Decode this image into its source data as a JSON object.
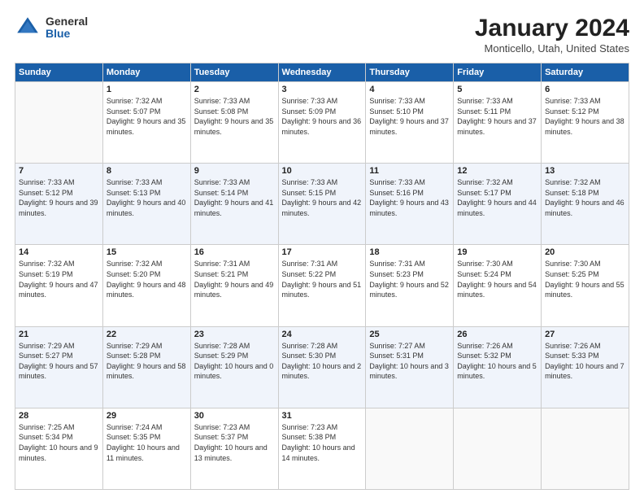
{
  "logo": {
    "general": "General",
    "blue": "Blue"
  },
  "header": {
    "title": "January 2024",
    "location": "Monticello, Utah, United States"
  },
  "days_of_week": [
    "Sunday",
    "Monday",
    "Tuesday",
    "Wednesday",
    "Thursday",
    "Friday",
    "Saturday"
  ],
  "weeks": [
    [
      {
        "day": "",
        "sunrise": "",
        "sunset": "",
        "daylight": ""
      },
      {
        "day": "1",
        "sunrise": "Sunrise: 7:32 AM",
        "sunset": "Sunset: 5:07 PM",
        "daylight": "Daylight: 9 hours and 35 minutes."
      },
      {
        "day": "2",
        "sunrise": "Sunrise: 7:33 AM",
        "sunset": "Sunset: 5:08 PM",
        "daylight": "Daylight: 9 hours and 35 minutes."
      },
      {
        "day": "3",
        "sunrise": "Sunrise: 7:33 AM",
        "sunset": "Sunset: 5:09 PM",
        "daylight": "Daylight: 9 hours and 36 minutes."
      },
      {
        "day": "4",
        "sunrise": "Sunrise: 7:33 AM",
        "sunset": "Sunset: 5:10 PM",
        "daylight": "Daylight: 9 hours and 37 minutes."
      },
      {
        "day": "5",
        "sunrise": "Sunrise: 7:33 AM",
        "sunset": "Sunset: 5:11 PM",
        "daylight": "Daylight: 9 hours and 37 minutes."
      },
      {
        "day": "6",
        "sunrise": "Sunrise: 7:33 AM",
        "sunset": "Sunset: 5:12 PM",
        "daylight": "Daylight: 9 hours and 38 minutes."
      }
    ],
    [
      {
        "day": "7",
        "sunrise": "Sunrise: 7:33 AM",
        "sunset": "Sunset: 5:12 PM",
        "daylight": "Daylight: 9 hours and 39 minutes."
      },
      {
        "day": "8",
        "sunrise": "Sunrise: 7:33 AM",
        "sunset": "Sunset: 5:13 PM",
        "daylight": "Daylight: 9 hours and 40 minutes."
      },
      {
        "day": "9",
        "sunrise": "Sunrise: 7:33 AM",
        "sunset": "Sunset: 5:14 PM",
        "daylight": "Daylight: 9 hours and 41 minutes."
      },
      {
        "day": "10",
        "sunrise": "Sunrise: 7:33 AM",
        "sunset": "Sunset: 5:15 PM",
        "daylight": "Daylight: 9 hours and 42 minutes."
      },
      {
        "day": "11",
        "sunrise": "Sunrise: 7:33 AM",
        "sunset": "Sunset: 5:16 PM",
        "daylight": "Daylight: 9 hours and 43 minutes."
      },
      {
        "day": "12",
        "sunrise": "Sunrise: 7:32 AM",
        "sunset": "Sunset: 5:17 PM",
        "daylight": "Daylight: 9 hours and 44 minutes."
      },
      {
        "day": "13",
        "sunrise": "Sunrise: 7:32 AM",
        "sunset": "Sunset: 5:18 PM",
        "daylight": "Daylight: 9 hours and 46 minutes."
      }
    ],
    [
      {
        "day": "14",
        "sunrise": "Sunrise: 7:32 AM",
        "sunset": "Sunset: 5:19 PM",
        "daylight": "Daylight: 9 hours and 47 minutes."
      },
      {
        "day": "15",
        "sunrise": "Sunrise: 7:32 AM",
        "sunset": "Sunset: 5:20 PM",
        "daylight": "Daylight: 9 hours and 48 minutes."
      },
      {
        "day": "16",
        "sunrise": "Sunrise: 7:31 AM",
        "sunset": "Sunset: 5:21 PM",
        "daylight": "Daylight: 9 hours and 49 minutes."
      },
      {
        "day": "17",
        "sunrise": "Sunrise: 7:31 AM",
        "sunset": "Sunset: 5:22 PM",
        "daylight": "Daylight: 9 hours and 51 minutes."
      },
      {
        "day": "18",
        "sunrise": "Sunrise: 7:31 AM",
        "sunset": "Sunset: 5:23 PM",
        "daylight": "Daylight: 9 hours and 52 minutes."
      },
      {
        "day": "19",
        "sunrise": "Sunrise: 7:30 AM",
        "sunset": "Sunset: 5:24 PM",
        "daylight": "Daylight: 9 hours and 54 minutes."
      },
      {
        "day": "20",
        "sunrise": "Sunrise: 7:30 AM",
        "sunset": "Sunset: 5:25 PM",
        "daylight": "Daylight: 9 hours and 55 minutes."
      }
    ],
    [
      {
        "day": "21",
        "sunrise": "Sunrise: 7:29 AM",
        "sunset": "Sunset: 5:27 PM",
        "daylight": "Daylight: 9 hours and 57 minutes."
      },
      {
        "day": "22",
        "sunrise": "Sunrise: 7:29 AM",
        "sunset": "Sunset: 5:28 PM",
        "daylight": "Daylight: 9 hours and 58 minutes."
      },
      {
        "day": "23",
        "sunrise": "Sunrise: 7:28 AM",
        "sunset": "Sunset: 5:29 PM",
        "daylight": "Daylight: 10 hours and 0 minutes."
      },
      {
        "day": "24",
        "sunrise": "Sunrise: 7:28 AM",
        "sunset": "Sunset: 5:30 PM",
        "daylight": "Daylight: 10 hours and 2 minutes."
      },
      {
        "day": "25",
        "sunrise": "Sunrise: 7:27 AM",
        "sunset": "Sunset: 5:31 PM",
        "daylight": "Daylight: 10 hours and 3 minutes."
      },
      {
        "day": "26",
        "sunrise": "Sunrise: 7:26 AM",
        "sunset": "Sunset: 5:32 PM",
        "daylight": "Daylight: 10 hours and 5 minutes."
      },
      {
        "day": "27",
        "sunrise": "Sunrise: 7:26 AM",
        "sunset": "Sunset: 5:33 PM",
        "daylight": "Daylight: 10 hours and 7 minutes."
      }
    ],
    [
      {
        "day": "28",
        "sunrise": "Sunrise: 7:25 AM",
        "sunset": "Sunset: 5:34 PM",
        "daylight": "Daylight: 10 hours and 9 minutes."
      },
      {
        "day": "29",
        "sunrise": "Sunrise: 7:24 AM",
        "sunset": "Sunset: 5:35 PM",
        "daylight": "Daylight: 10 hours and 11 minutes."
      },
      {
        "day": "30",
        "sunrise": "Sunrise: 7:23 AM",
        "sunset": "Sunset: 5:37 PM",
        "daylight": "Daylight: 10 hours and 13 minutes."
      },
      {
        "day": "31",
        "sunrise": "Sunrise: 7:23 AM",
        "sunset": "Sunset: 5:38 PM",
        "daylight": "Daylight: 10 hours and 14 minutes."
      },
      {
        "day": "",
        "sunrise": "",
        "sunset": "",
        "daylight": ""
      },
      {
        "day": "",
        "sunrise": "",
        "sunset": "",
        "daylight": ""
      },
      {
        "day": "",
        "sunrise": "",
        "sunset": "",
        "daylight": ""
      }
    ]
  ]
}
